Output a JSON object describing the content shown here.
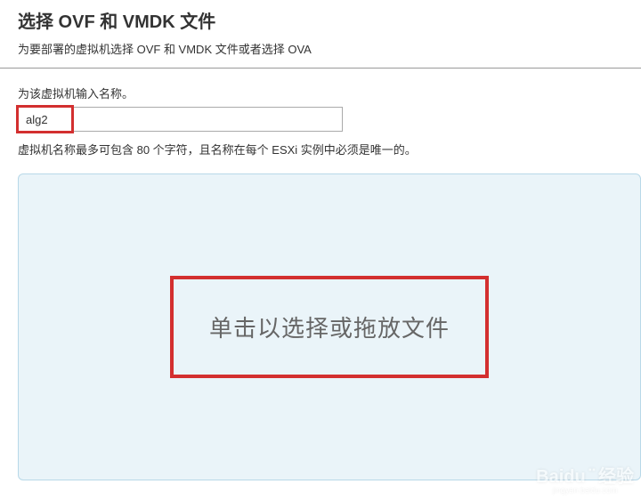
{
  "header": {
    "title": "选择 OVF 和 VMDK 文件",
    "subtitle": "为要部署的虚拟机选择 OVF 和 VMDK 文件或者选择 OVA"
  },
  "form": {
    "name_label": "为该虚拟机输入名称。",
    "name_value": "alg2",
    "name_hint": "虚拟机名称最多可包含 80 个字符，且名称在每个 ESXi 实例中必须是唯一的。"
  },
  "dropzone": {
    "text": "单击以选择或拖放文件"
  },
  "watermark": {
    "brand": "Baidu",
    "suffix": "经验",
    "url": "jingyan.baidu.com"
  }
}
